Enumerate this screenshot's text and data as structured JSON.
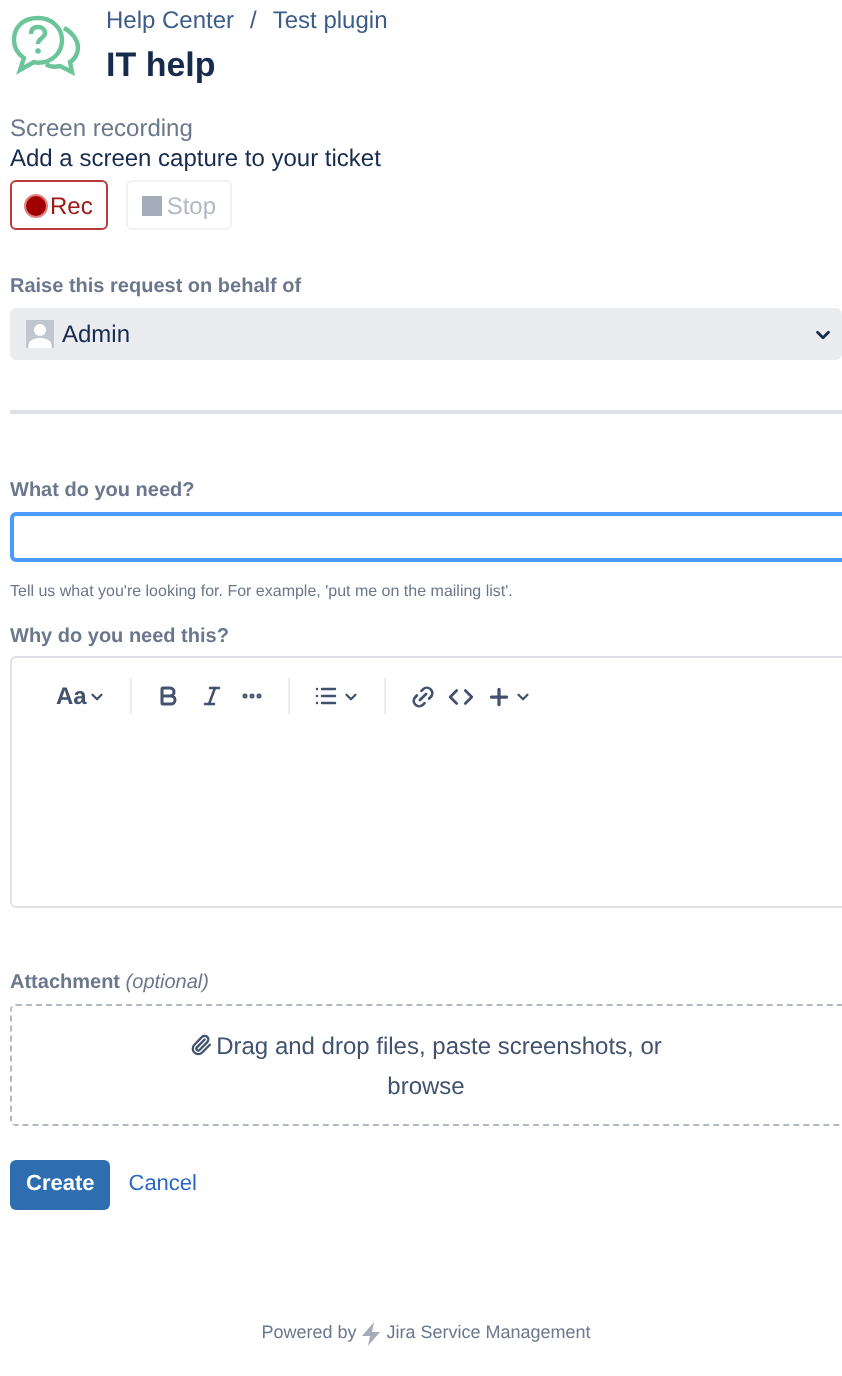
{
  "breadcrumbs": [
    "Help Center",
    "Test plugin"
  ],
  "breadcrumb_separator": "/",
  "title": "IT help",
  "recording": {
    "label": "Screen recording",
    "description": "Add a screen capture to your ticket",
    "buttons": [
      {
        "kind": "rec",
        "label": "Rec",
        "disabled": false
      },
      {
        "kind": "stop",
        "label": "Stop",
        "disabled": true
      }
    ]
  },
  "on_behalf": {
    "label": "Raise this request on behalf of",
    "value": "Admin"
  },
  "summary": {
    "label": "What do you need?",
    "focused": true,
    "hint": "Tell us what you're looking for. For example, 'put me on the mailing list'."
  },
  "description": {
    "label": "Why do you need this?",
    "text_style": "Aa"
  },
  "attachment": {
    "label": "Attachment",
    "optional": "(optional)",
    "drop_text": "Drag and drop files, paste screenshots, or",
    "browse": "browse"
  },
  "actions": {
    "create": "Create",
    "cancel": "Cancel"
  },
  "footer": {
    "powered_by": "Powered by",
    "product": "Jira Service Management"
  }
}
